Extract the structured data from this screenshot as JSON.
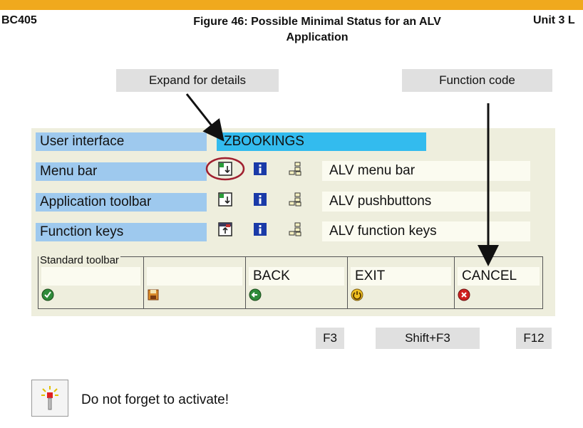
{
  "header": {
    "left": "BC405",
    "title_line1": "Figure 46: Possible Minimal Status for an ALV",
    "title_line2": "Application",
    "right": "Unit 3 L"
  },
  "callouts": {
    "expand": "Expand for details",
    "function_code": "Function code"
  },
  "status": {
    "user_interface_label": "User interface",
    "user_interface_value": "ZBOOKINGS",
    "rows": [
      {
        "label": "Menu bar",
        "value": "ALV menu bar"
      },
      {
        "label": "Application toolbar",
        "value": "ALV pushbuttons"
      },
      {
        "label": "Function keys",
        "value": "ALV function keys"
      }
    ]
  },
  "standard_toolbar": {
    "caption": "Standard toolbar",
    "cells": [
      {
        "code": "",
        "icon": "check-icon"
      },
      {
        "code": "",
        "icon": "save-icon"
      },
      {
        "code": "BACK",
        "icon": "back-icon"
      },
      {
        "code": "EXIT",
        "icon": "exit-icon"
      },
      {
        "code": "CANCEL",
        "icon": "cancel-icon"
      }
    ]
  },
  "function_keys": [
    "F3",
    "Shift+F3",
    "F12"
  ],
  "note": {
    "text": "Do not forget to activate!",
    "icon": "activate-wand-icon"
  },
  "colors": {
    "accent_bar": "#f0a91d",
    "label_blue": "#9ec9ee",
    "value_blue": "#33bbee",
    "highlight_circle": "#a02030"
  }
}
